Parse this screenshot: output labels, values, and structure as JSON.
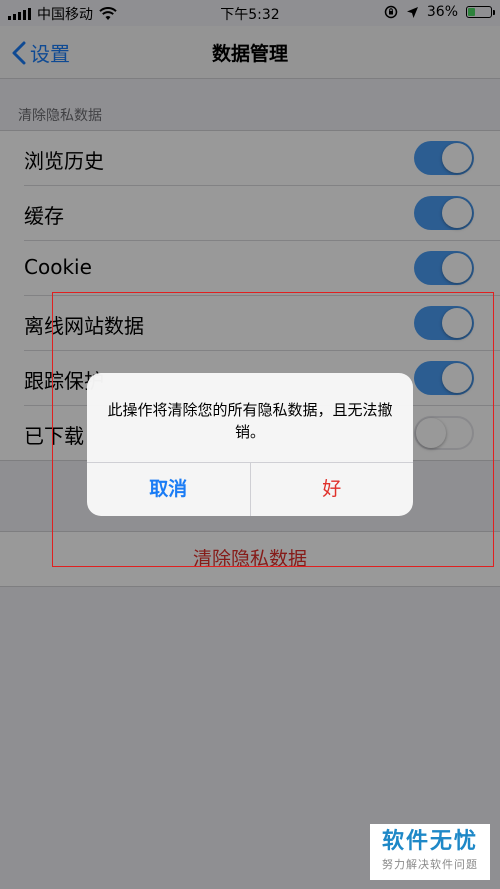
{
  "status_bar": {
    "carrier": "中国移动",
    "time": "下午5:32",
    "battery": "36%",
    "battery_level": 0.36
  },
  "nav": {
    "back_label": "设置",
    "title": "数据管理"
  },
  "section": {
    "header": "清除隐私数据",
    "items": [
      {
        "label": "浏览历史",
        "on": true
      },
      {
        "label": "缓存",
        "on": true
      },
      {
        "label": "Cookie",
        "on": true
      },
      {
        "label": "离线网站数据",
        "on": true
      },
      {
        "label": "跟踪保护",
        "on": true
      },
      {
        "label": "已下载",
        "on": false
      }
    ]
  },
  "clear_button": "清除隐私数据",
  "alert": {
    "message": "此操作将清除您的所有隐私数据，且无法撤销。",
    "cancel": "取消",
    "ok": "好"
  },
  "watermark": {
    "main": "软件无忧",
    "sub": "努力解决软件问题"
  },
  "colors": {
    "accent": "#1a7cf5",
    "toggle_on": "#4a9bf2",
    "destructive": "#e0302a",
    "annotation": "#e02020"
  }
}
